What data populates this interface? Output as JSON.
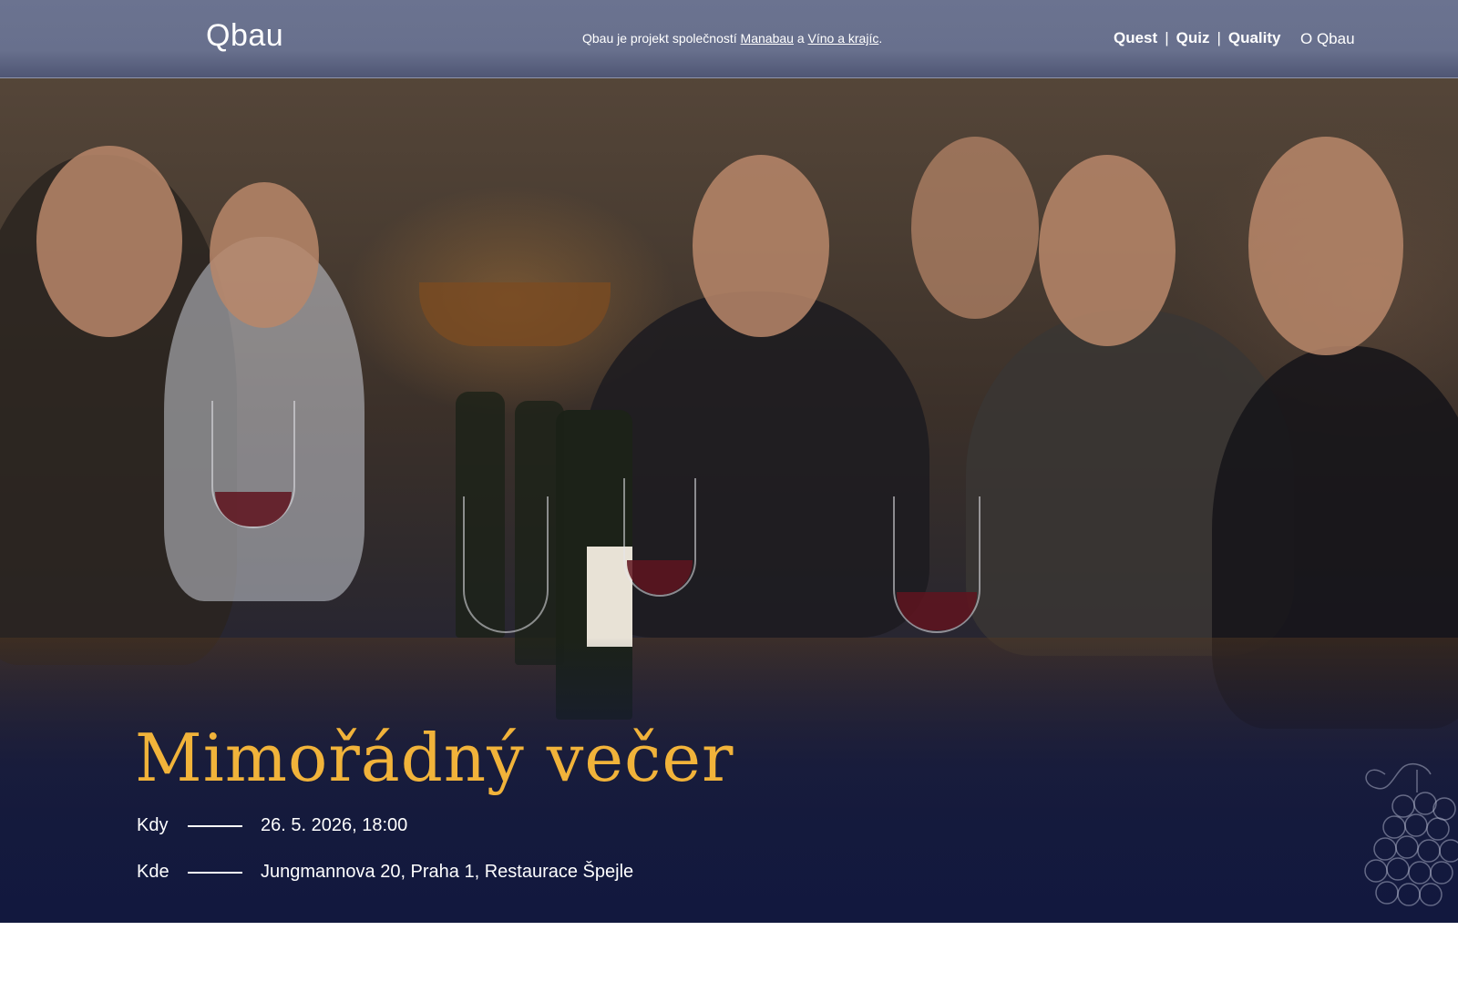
{
  "header": {
    "logo": "Qbau",
    "tagline": {
      "prefix": "Qbau je projekt společností",
      "link1": "Manabau",
      "middle": "a",
      "link2": "Víno a krajíc",
      "suffix": "."
    },
    "nav": [
      "Quest",
      "Quiz",
      "Quality"
    ],
    "nav_separator": "|",
    "about": "O Qbau"
  },
  "hero": {
    "title": "Mimořádný večer",
    "when_label": "Kdy",
    "when_value": "26. 5. 2026, 18:00",
    "where_label": "Kde",
    "where_value": "Jungmannova 20, Praha 1, Restaurace Špejle"
  },
  "colors": {
    "header_bg": "#6b7390",
    "title_accent": "#f1b33a",
    "hero_bottom": "#141a3a"
  },
  "icons": {
    "decoration": "grapes-icon"
  }
}
